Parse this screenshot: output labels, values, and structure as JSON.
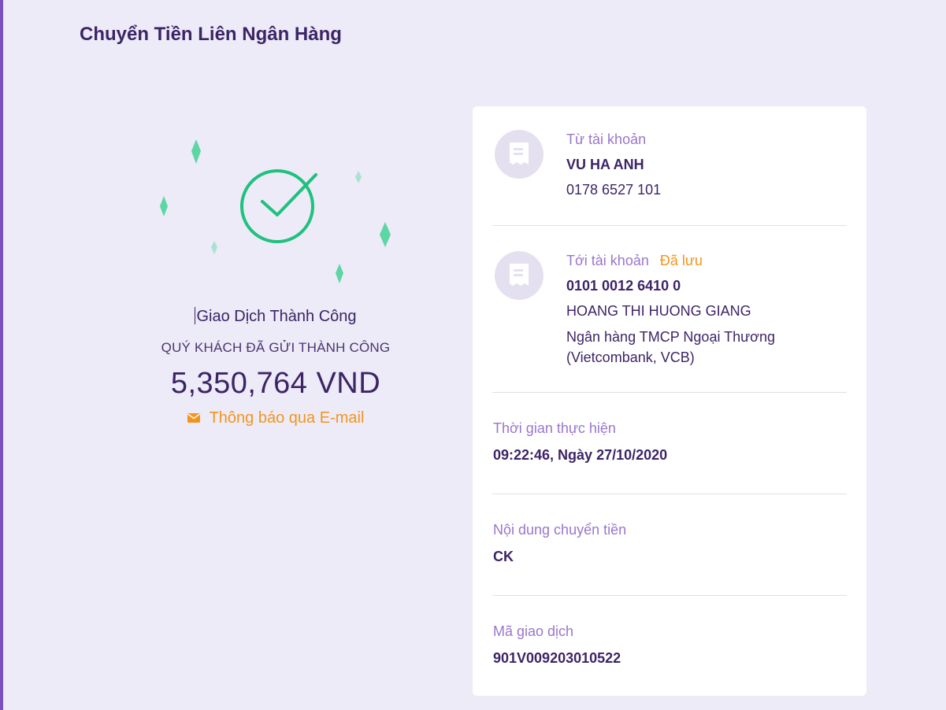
{
  "page": {
    "title": "Chuyển Tiền Liên Ngân Hàng"
  },
  "result": {
    "status_title": "Giao Dịch Thành Công",
    "status_subtitle": "QUÝ KHÁCH ĐÃ GỬI THÀNH CÔNG",
    "amount": "5,350,764 VND",
    "email_notice": "Thông báo qua E-mail",
    "colors": {
      "check": "#1fc17e",
      "sparkle": "#5cd6a3",
      "email": "#f5941d"
    }
  },
  "from_account": {
    "label": "Từ tài khoản",
    "name": "VU HA ANH",
    "number": "0178 6527 101",
    "icon": "receipt-icon"
  },
  "to_account": {
    "label": "Tới tài khoản",
    "saved_badge": "Đã lưu",
    "number": "0101 0012 6410 0",
    "name": "HOANG THI HUONG GIANG",
    "bank_line1": "Ngân hàng TMCP Ngoại Thương",
    "bank_line2": "(Vietcombank, VCB)",
    "icon": "receipt-icon"
  },
  "time": {
    "label": "Thời gian thực hiện",
    "value": "09:22:46, Ngày 27/10/2020"
  },
  "content": {
    "label": "Nội dung chuyển tiền",
    "value": "CK"
  },
  "transaction": {
    "label": "Mã giao dịch",
    "value": "901V009203010522"
  }
}
